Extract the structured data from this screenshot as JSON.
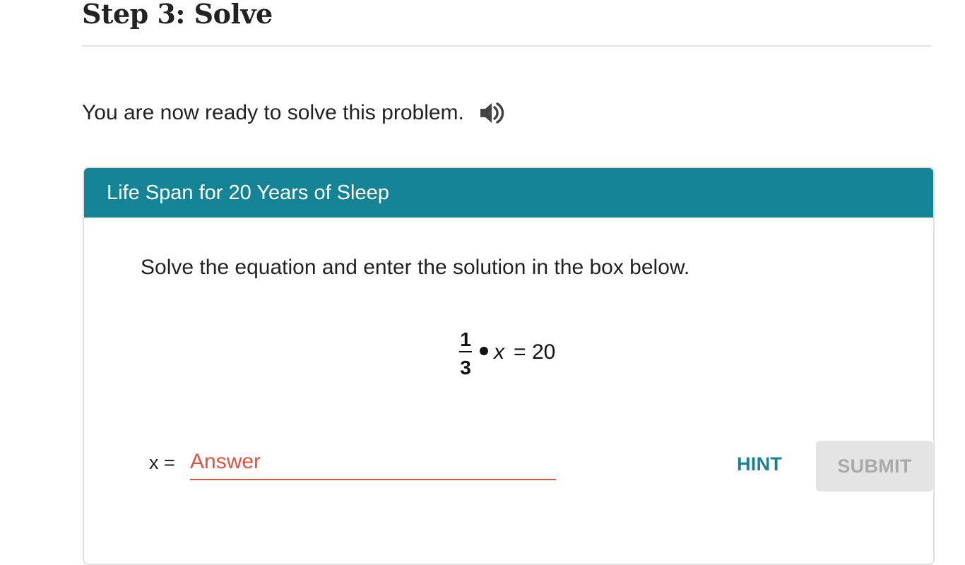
{
  "step": {
    "title": "Step 3: Solve"
  },
  "intro": {
    "text": "You are now ready to solve this problem.",
    "audio_icon": "speaker-icon"
  },
  "problem": {
    "header": "Life Span for 20 Years of Sleep",
    "instruction": "Solve the equation and enter the solution in the box below.",
    "equation": {
      "numerator": "1",
      "denominator": "3",
      "dot": "•",
      "variable": "x",
      "equals": "=",
      "rhs": "20"
    },
    "answer": {
      "label": "x =",
      "value": "",
      "placeholder": "Answer"
    },
    "hint_label": "HINT",
    "submit_label": "SUBMIT"
  },
  "colors": {
    "header_bg": "#148396",
    "accent": "#148396",
    "input_underline": "#e2503f",
    "submit_disabled_bg": "#e4e4e4",
    "submit_disabled_text": "#a9a9a9"
  }
}
